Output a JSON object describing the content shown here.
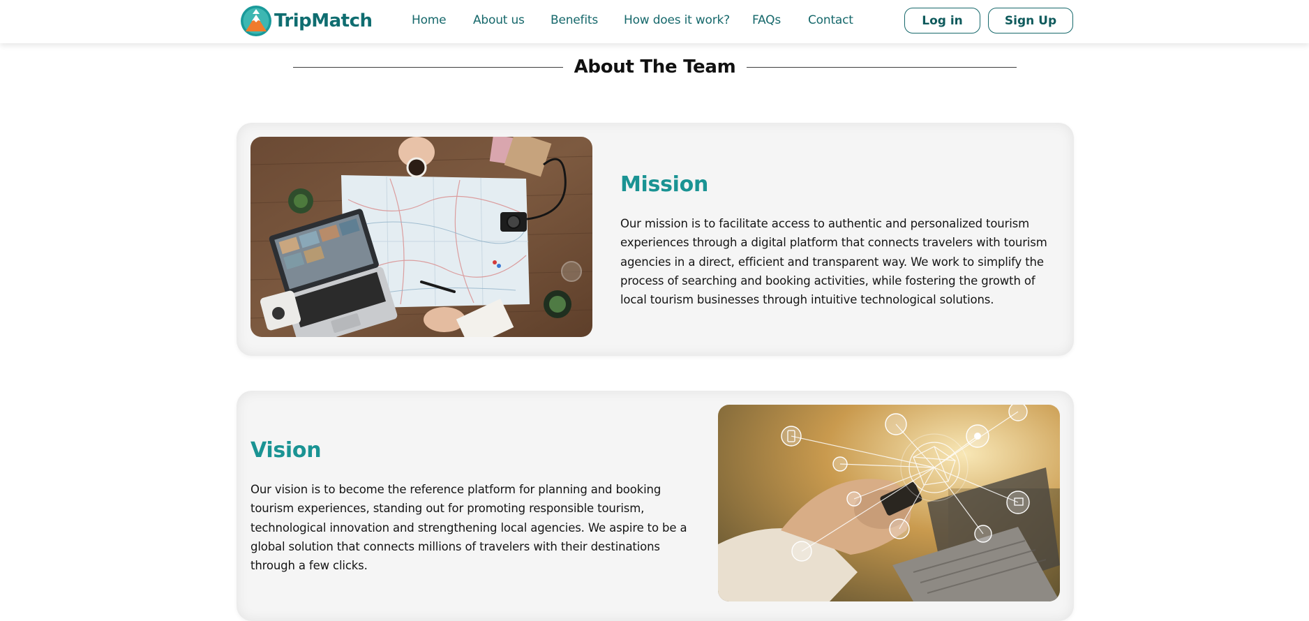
{
  "header": {
    "brand": "TripMatch",
    "nav": [
      "Home",
      "About us",
      "Benefits",
      "How does it work?",
      "FAQs",
      "Contact"
    ],
    "login_label": "Log in",
    "signup_label": "Sign Up"
  },
  "section": {
    "title": "About The Team"
  },
  "mission": {
    "heading": "Mission",
    "text": "Our mission is to facilitate access to authentic and personalized tourism experiences through a digital platform that connects travelers with tourism agencies in a direct, efficient and transparent way. We work to simplify the process of searching and booking activities, while fostering the growth of local tourism businesses through intuitive technological solutions."
  },
  "vision": {
    "heading": "Vision",
    "text": "Our vision is to become the reference platform for planning and booking tourism experiences, standing out for promoting responsible tourism, technological innovation and strengthening local agencies. We aspire to be a global solution that connects millions of travelers with their destinations through a few clicks."
  },
  "colors": {
    "brand_teal": "#16686b",
    "heading_teal": "#1a9393",
    "logo_orange": "#f07b2c",
    "card_bg": "#f5f5f5"
  },
  "icons": [
    "tripmatch-logo-icon"
  ]
}
